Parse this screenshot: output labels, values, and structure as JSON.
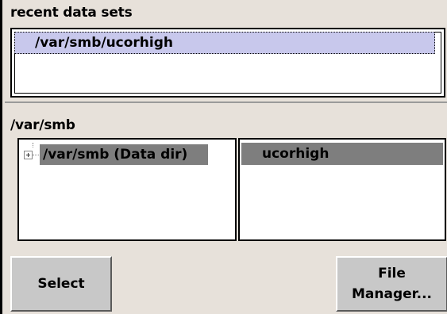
{
  "recent": {
    "label": "recent data sets",
    "items": [
      "/var/smb/ucorhigh"
    ]
  },
  "browser": {
    "path_label": "/var/smb",
    "tree_node": "/var/smb (Data dir)",
    "files": [
      "ucorhigh"
    ]
  },
  "buttons": {
    "select": "Select",
    "file_manager_line1": "File",
    "file_manager_line2": "Manager..."
  }
}
